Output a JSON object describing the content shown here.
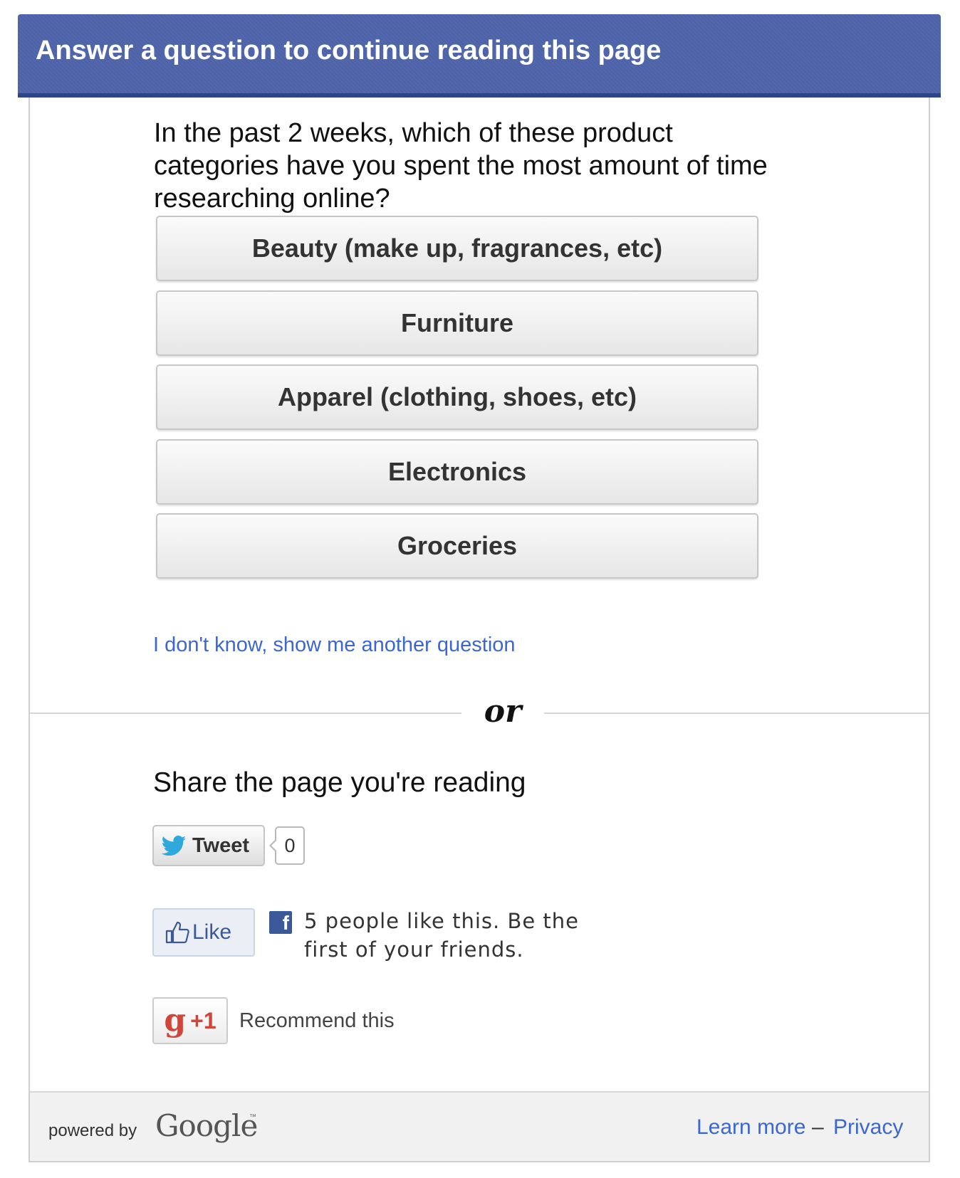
{
  "header": {
    "title": "Answer a question to continue reading this page"
  },
  "survey": {
    "question": "In the past 2 weeks, which of these product categories have you spent the most amount of time researching online?",
    "answers": [
      "Beauty (make up, fragrances, etc)",
      "Furniture",
      "Apparel (clothing, shoes, etc)",
      "Electronics",
      "Groceries"
    ],
    "skip_link": "I don't know, show me another question"
  },
  "divider": {
    "or_text": "or"
  },
  "share": {
    "title": "Share the page you're reading",
    "tweet": {
      "label": "Tweet",
      "count": "0",
      "icon": "twitter-bird-icon"
    },
    "facebook": {
      "like_label": "Like",
      "like_icon": "thumbs-up-icon",
      "social_text": "5 people like this. Be the first of your friends.",
      "icon": "facebook-icon",
      "icon_glyph": "f"
    },
    "gplus": {
      "g_glyph": "g",
      "plus_label": "+1",
      "recommend_text": "Recommend this"
    }
  },
  "footer": {
    "powered_by": "powered by",
    "brand": "Google",
    "trademark": "™",
    "learn_more": "Learn more",
    "separator": "–",
    "privacy": "Privacy"
  },
  "colors": {
    "header_bg": "#4f65aa",
    "header_border": "#2c4689",
    "link": "#3b67cf",
    "facebook_blue": "#3b5998",
    "gplus_red": "#d0463a",
    "twitter_blue": "#2fa8dd"
  }
}
